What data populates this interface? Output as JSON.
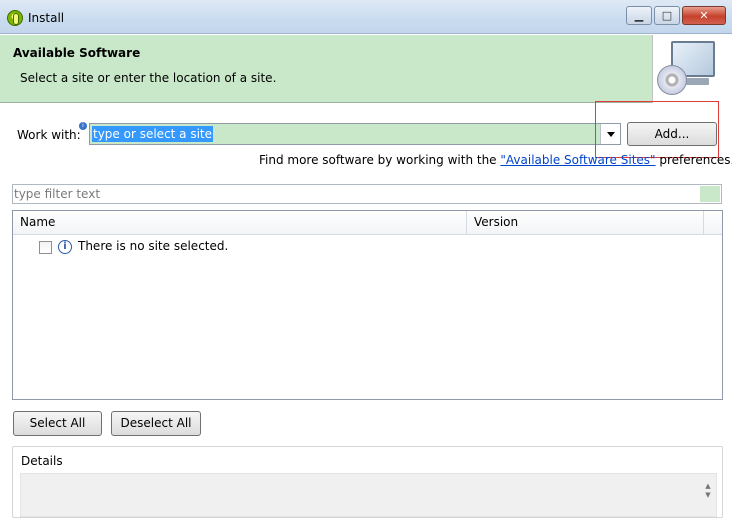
{
  "window": {
    "title": "Install",
    "minimize_glyph": "▁",
    "maximize_glyph": "□",
    "close_glyph": "✕"
  },
  "banner": {
    "title": "Available Software",
    "description": "Select a site or enter the location of a site.",
    "image_icon": "monitor-cd-icon",
    "background_color": "#c9e8c9"
  },
  "work_with": {
    "label": "Work with:",
    "value": "type or select a site",
    "add_button": "Add..."
  },
  "find_more": {
    "prefix": "Find more software by working with the ",
    "link": "\"Available Software Sites\"",
    "suffix": " preferences."
  },
  "filter": {
    "placeholder": "type filter text"
  },
  "table": {
    "columns": [
      "Name",
      "Version"
    ],
    "rows": [
      {
        "checked": false,
        "icon": "info-icon",
        "label": "There is no site selected."
      }
    ]
  },
  "buttons": {
    "select_all": "Select All",
    "deselect_all": "Deselect All"
  },
  "details": {
    "label": "Details"
  },
  "colors": {
    "highlight_border": "#e23b3b",
    "selection": "#3399ff",
    "link": "#0044cc"
  }
}
